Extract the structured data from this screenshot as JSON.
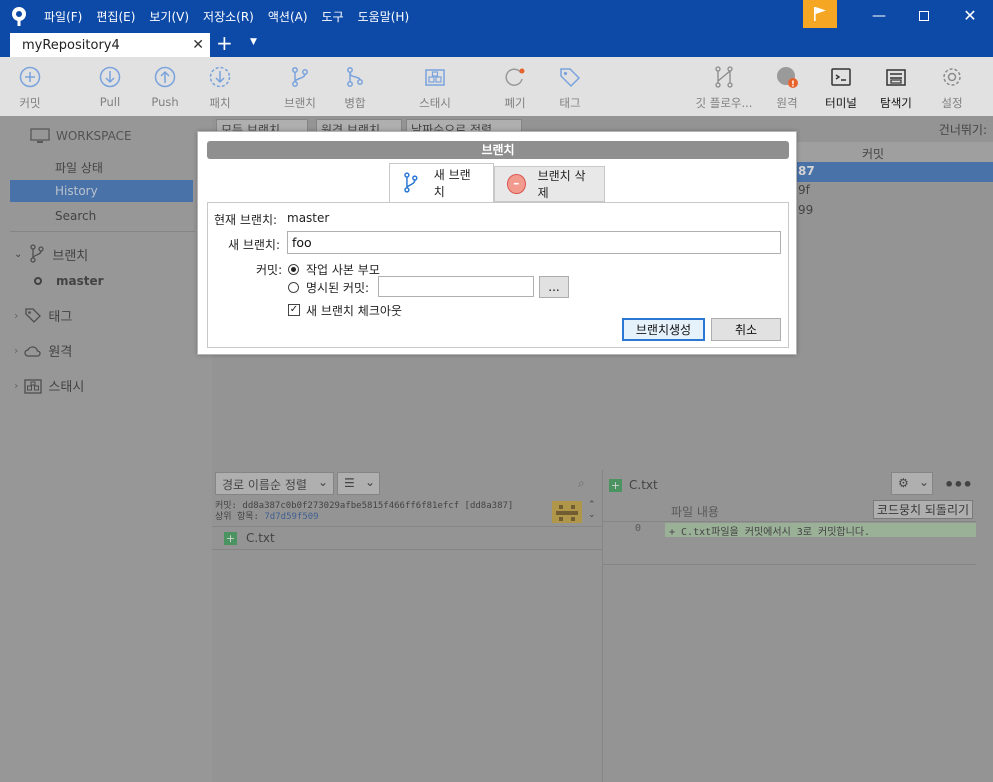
{
  "menu": [
    "파일(F)",
    "편집(E)",
    "보기(V)",
    "저장소(R)",
    "액션(A)",
    "도구",
    "도움말(H)"
  ],
  "tab": {
    "title": "myRepository4"
  },
  "toolbar": {
    "commit": "커밋",
    "pull": "Pull",
    "push": "Push",
    "fetch": "패치",
    "branch": "브랜치",
    "merge": "병합",
    "stash": "스태시",
    "discard": "폐기",
    "tag": "태그",
    "gitflow": "깃 플로우...",
    "remote": "원격",
    "terminal": "터미널",
    "explorer": "탐색기",
    "settings": "설정"
  },
  "sidebar": {
    "workspace": "WORKSPACE",
    "file_status": "파일 상태",
    "history": "History",
    "search": "Search",
    "branches": "브랜치",
    "master": "master",
    "tags": "태그",
    "remotes": "원격",
    "stashes": "스태시"
  },
  "main": {
    "all_branches": "모든 브랜치",
    "remote_branches": "원격 브랜치",
    "date_order": "날짜순으로 정렬",
    "skip": "건너뛰기:",
    "commit_col": "커밋",
    "rows": [
      "87",
      "9f",
      "99"
    ]
  },
  "bottom": {
    "sort": "경로 이름순 정렬",
    "commit_line": "커밋: dd8a387c0b0f273029afbe5815f466ff6f81efcf [dd8a387]",
    "parent_label": "상위 항목:",
    "parent_hash": "7d7d59f509",
    "file": "C.txt",
    "file_content": "파일 내용",
    "revert_hunk": "코드뭉치 되돌리기",
    "line_no": "0",
    "line_text": "+ C.txt파일을 커밋에서시 3로 커밋합니다."
  },
  "dialog": {
    "title": "브랜치",
    "tab_new": "새 브랜치",
    "tab_delete": "브랜치 삭제",
    "current_branch_label": "현재 브랜치:",
    "current_branch": "master",
    "new_branch_label": "새 브랜치:",
    "new_branch_value": "foo",
    "commit_label": "커밋:",
    "opt_working_parent": "작업 사본 부모",
    "opt_specified": "명시된 커밋:",
    "browse": "...",
    "checkout_label": "새 브랜치 체크아웃",
    "create_button": "브랜치생성",
    "cancel_button": "취소"
  },
  "colors": {
    "accent": "#0d4aa8",
    "selection": "#2c6bbf",
    "flag": "#f5a623"
  }
}
